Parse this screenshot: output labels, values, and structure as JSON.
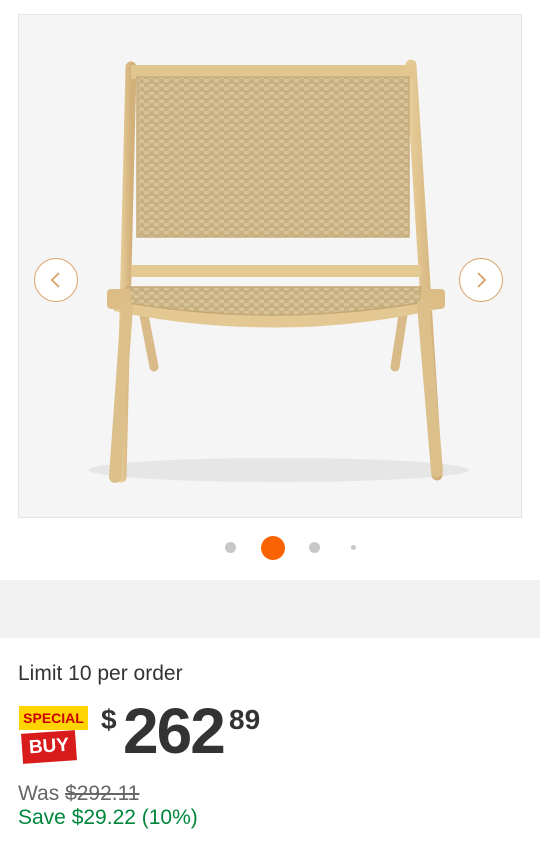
{
  "gallery": {
    "image_alt": "Woven rope folding lounge chair with light wood frame",
    "prev_icon": "chevron-left-icon",
    "next_icon": "chevron-right-icon",
    "active_dot": 2,
    "dot_count": 4,
    "arrow_color": "#d9a066",
    "active_dot_color": "#f96302"
  },
  "purchase": {
    "limit_text": "Limit 10 per order",
    "badge_top": "SPECIAL",
    "badge_bottom": "BUY",
    "currency_symbol": "$",
    "price_dollars": "262",
    "price_cents": "89",
    "was_label": "Was",
    "was_price": "$292.11",
    "save_text": "Save $29.22 (10%)",
    "save_color": "#00873c"
  }
}
